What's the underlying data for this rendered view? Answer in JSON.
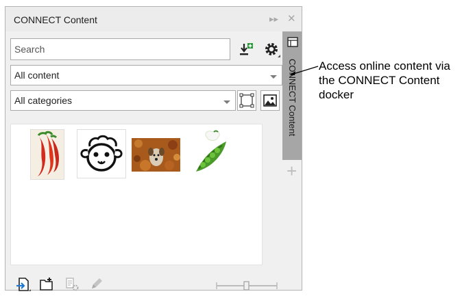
{
  "docker": {
    "title": "CONNECT Content",
    "search_placeholder": "Search",
    "content_filter": "All content",
    "category_filter": "All categories",
    "side_tab_label": "CONNECT Content",
    "thumbnails": [
      {
        "name": "chili-peppers"
      },
      {
        "name": "sheep-face"
      },
      {
        "name": "dog-in-leaves"
      },
      {
        "name": "green-peas"
      }
    ],
    "toolbar_icons": [
      "import-icon",
      "new-folder-icon",
      "properties-icon",
      "edit-icon"
    ],
    "zoom_slider_value": 0.5
  },
  "callout": {
    "text": "Access online content via the CONNECT Content docker"
  },
  "colors": {
    "panel": "#f0f0f0",
    "tab": "#a6a6a6",
    "accent_green": "#2f9a3b",
    "accent_blue": "#1f78d1"
  }
}
